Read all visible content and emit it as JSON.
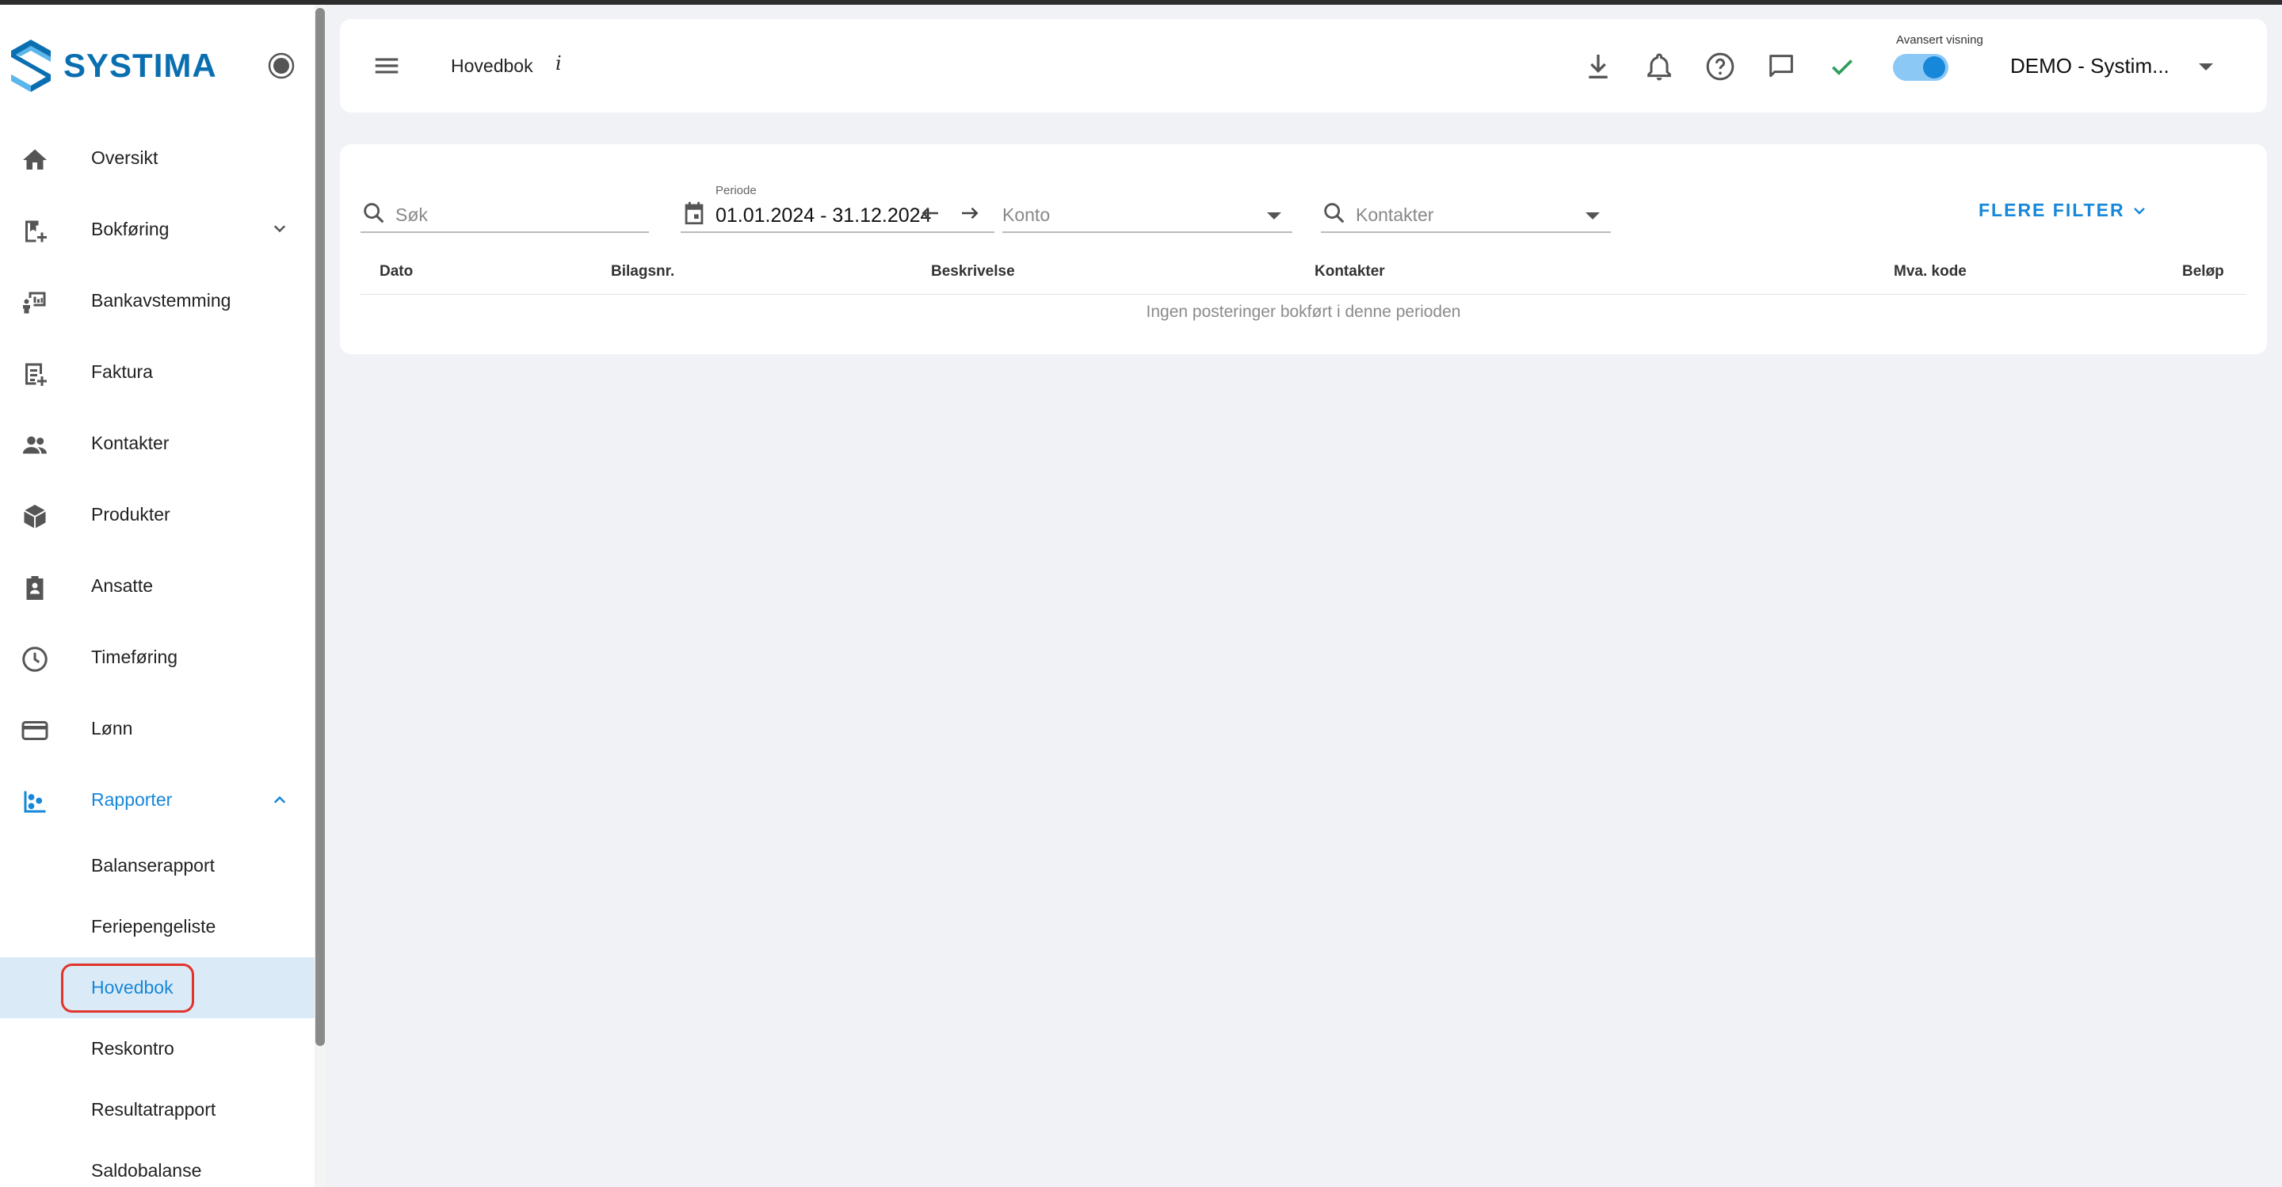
{
  "app": {
    "brand": "SYSTIMA",
    "brand_color": "#0a6fb1",
    "accent": "#1687d9"
  },
  "sidebar": {
    "items": [
      {
        "label": "Oversikt",
        "icon": "home-icon"
      },
      {
        "label": "Bokføring",
        "icon": "bookmark-add-icon",
        "expandable": true,
        "expanded": false
      },
      {
        "label": "Bankavstemming",
        "icon": "bank-reconcile-icon"
      },
      {
        "label": "Faktura",
        "icon": "invoice-icon"
      },
      {
        "label": "Kontakter",
        "icon": "people-icon"
      },
      {
        "label": "Produkter",
        "icon": "box-icon"
      },
      {
        "label": "Ansatte",
        "icon": "badge-icon"
      },
      {
        "label": "Timeføring",
        "icon": "clock-icon"
      },
      {
        "label": "Lønn",
        "icon": "card-icon"
      },
      {
        "label": "Rapporter",
        "icon": "reports-icon",
        "expandable": true,
        "expanded": true,
        "active": true
      }
    ],
    "sub_items": [
      {
        "label": "Balanserapport"
      },
      {
        "label": "Feriepengeliste"
      },
      {
        "label": "Hovedbok",
        "selected": true
      },
      {
        "label": "Reskontro"
      },
      {
        "label": "Resultatrapport"
      },
      {
        "label": "Saldobalanse"
      }
    ]
  },
  "header": {
    "title": "Hovedbok",
    "info_glyph": "i",
    "advanced_label": "Avansert visning",
    "advanced_on": true,
    "company": "DEMO - Systim..."
  },
  "filters": {
    "search_placeholder": "Søk",
    "period_label": "Periode",
    "period_value": "01.01.2024 - 31.12.2024",
    "account_placeholder": "Konto",
    "contacts_placeholder": "Kontakter",
    "more_filters": "FLERE FILTER"
  },
  "table": {
    "columns": [
      "Dato",
      "Bilagsnr.",
      "Beskrivelse",
      "Kontakter",
      "Mva. kode",
      "Beløp"
    ],
    "empty_message": "Ingen posteringer bokført i denne perioden"
  }
}
